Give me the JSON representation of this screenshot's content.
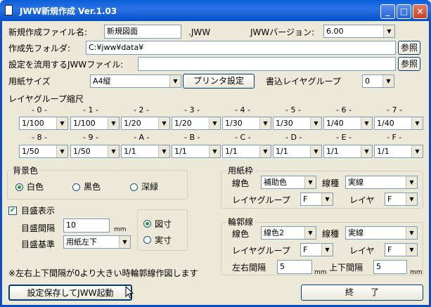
{
  "window": {
    "title": "JWW新規作成 Ver.1.03"
  },
  "row1": {
    "filename_label": "新規作成ファイル名:",
    "filename_value": "新規図面",
    "ext": ".JWW",
    "version_label": "JWWバージョン:",
    "version_value": "6.00"
  },
  "row2": {
    "folder_label": "作成先フォルダ:",
    "folder_value": "C:¥jww¥data¥",
    "browse": "参照"
  },
  "row3": {
    "template_label": "設定を流用するJWWファイル:",
    "template_value": "",
    "browse": "参照"
  },
  "row4": {
    "paper_label": "用紙サイズ",
    "paper_value": "A4縦",
    "printer_button": "プリンタ設定",
    "write_layer_label": "書込レイヤグループ",
    "write_layer_value": "0"
  },
  "scale": {
    "heading": "レイヤグループ縮尺",
    "headers1": [
      "- 0 -",
      "- 1 -",
      "- 2 -",
      "- 3 -",
      "- 4 -",
      "- 5 -",
      "- 6 -",
      "- 7 -"
    ],
    "values1": [
      "1/100",
      "1/100",
      "1/20",
      "1/20",
      "1/30",
      "1/30",
      "1/40",
      "1/40"
    ],
    "headers2": [
      "- 8 -",
      "- 9 -",
      "- A -",
      "- B -",
      "- C -",
      "- D -",
      "- E -",
      "- F -"
    ],
    "values2": [
      "1/50",
      "1/50",
      "1/1",
      "1/1",
      "1/1",
      "1/1",
      "1/1",
      "1/1"
    ]
  },
  "background": {
    "label": "背景色",
    "options": [
      "白色",
      "黒色",
      "深緑"
    ],
    "selected": "白色"
  },
  "grid": {
    "show_label": "目盛表示",
    "interval_label": "目盛間隔",
    "interval_value": "10",
    "interval_unit": "mm",
    "base_label": "目盛基準",
    "base_value": "用紙左下",
    "radio_options": [
      "図寸",
      "実寸"
    ],
    "radio_selected": "図寸"
  },
  "paper_frame": {
    "label": "用紙枠",
    "color_label": "線色",
    "color_value": "補助色",
    "type_label": "線種",
    "type_value": "実線",
    "group_label": "レイヤグループ",
    "group_value": "F",
    "layer_label": "レイヤ",
    "layer_value": "F"
  },
  "border": {
    "label": "輪郭線",
    "color_label": "線色",
    "color_value": "線色2",
    "type_label": "線種",
    "type_value": "実線",
    "group_label": "レイヤグループ",
    "group_value": "F",
    "layer_label": "レイヤ",
    "layer_value": "F",
    "lr_label": "左右間隔",
    "lr_value": "5",
    "tb_label": "上下間隔",
    "tb_value": "5",
    "unit": "mm"
  },
  "note": "※左右上下間隔が0より大きい時輪郭線作図します",
  "footer": {
    "save_start": "設定保存してJWW起動",
    "exit": "終　　了"
  }
}
